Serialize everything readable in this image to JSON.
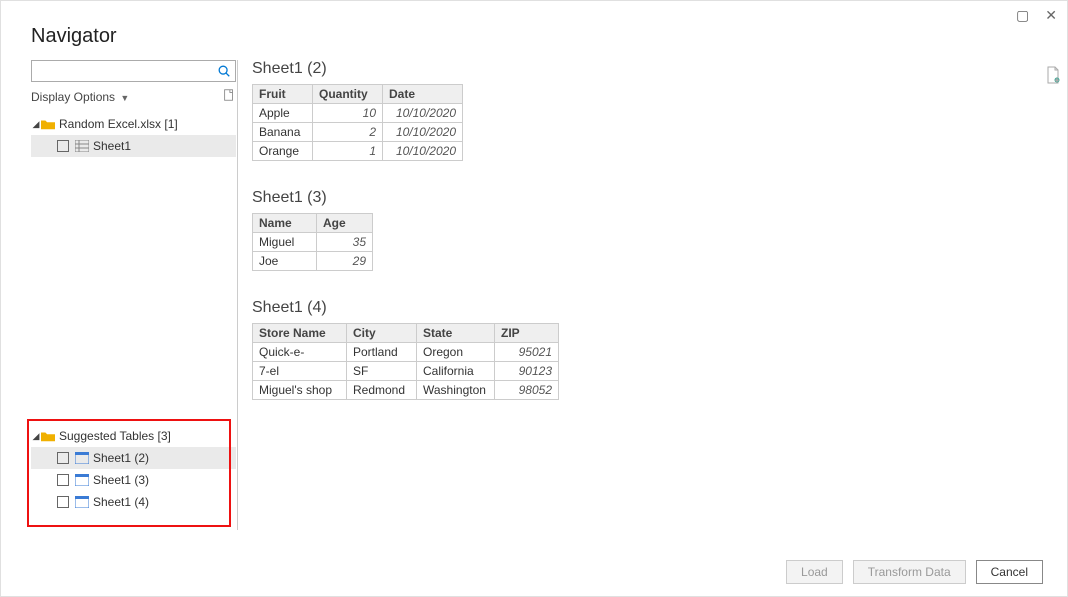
{
  "window": {
    "title": "Navigator"
  },
  "left": {
    "displayOptions": "Display Options",
    "file": {
      "label": "Random Excel.xlsx [1]"
    },
    "fileChild": {
      "label": "Sheet1"
    },
    "suggested": {
      "label": "Suggested Tables [3]"
    },
    "suggestedChildren": {
      "0": {
        "label": "Sheet1 (2)"
      },
      "1": {
        "label": "Sheet1 (3)"
      },
      "2": {
        "label": "Sheet1 (4)"
      }
    }
  },
  "previews": {
    "t1": {
      "title": "Sheet1 (2)",
      "h0": "Fruit",
      "h1": "Quantity",
      "h2": "Date",
      "r0c0": "Apple",
      "r0c1": "10",
      "r0c2": "10/10/2020",
      "r1c0": "Banana",
      "r1c1": "2",
      "r1c2": "10/10/2020",
      "r2c0": "Orange",
      "r2c1": "1",
      "r2c2": "10/10/2020"
    },
    "t2": {
      "title": "Sheet1 (3)",
      "h0": "Name",
      "h1": "Age",
      "r0c0": "Miguel",
      "r0c1": "35",
      "r1c0": "Joe",
      "r1c1": "29"
    },
    "t3": {
      "title": "Sheet1 (4)",
      "h0": "Store Name",
      "h1": "City",
      "h2": "State",
      "h3": "ZIP",
      "r0c0": "Quick-e-",
      "r0c1": "Portland",
      "r0c2": "Oregon",
      "r0c3": "95021",
      "r1c0": "7-el",
      "r1c1": "SF",
      "r1c2": "California",
      "r1c3": "90123",
      "r2c0": "Miguel's shop",
      "r2c1": "Redmond",
      "r2c2": "Washington",
      "r2c3": "98052"
    }
  },
  "footer": {
    "load": "Load",
    "transform": "Transform Data",
    "cancel": "Cancel"
  },
  "cols": {
    "t1c0": "60px",
    "t1c1": "70px",
    "t1c2": "80px",
    "t2c0": "64px",
    "t2c1": "56px",
    "t3c0": "94px",
    "t3c1": "70px",
    "t3c2": "78px",
    "t3c3": "64px"
  }
}
